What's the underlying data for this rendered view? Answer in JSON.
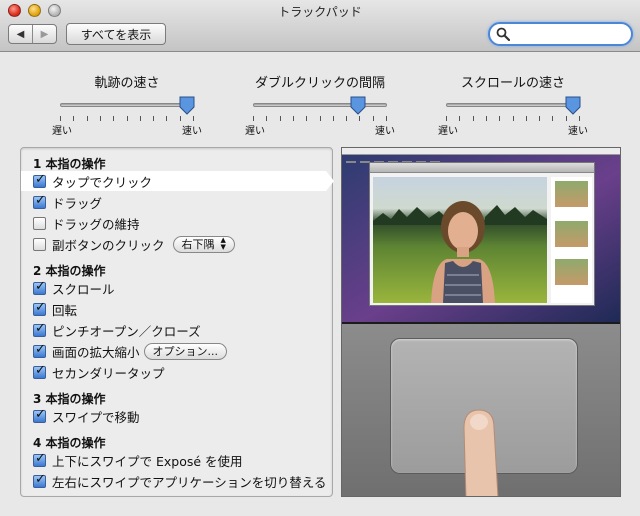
{
  "window": {
    "title": "トラックパッド"
  },
  "toolbar": {
    "back_label": "◀",
    "forward_label": "▶",
    "show_all_label": "すべてを表示",
    "search_value": "",
    "search_placeholder": ""
  },
  "sliders": [
    {
      "title": "軌跡の速さ",
      "min_label": "遅い",
      "max_label": "速い",
      "value_fraction": 0.95
    },
    {
      "title": "ダブルクリックの間隔",
      "min_label": "遅い",
      "max_label": "速い",
      "value_fraction": 0.78
    },
    {
      "title": "スクロールの速さ",
      "min_label": "遅い",
      "max_label": "速い",
      "value_fraction": 0.95
    }
  ],
  "options": {
    "one_finger": {
      "title": "1 本指の操作",
      "tap_to_click": {
        "label": "タップでクリック",
        "checked": true
      },
      "dragging": {
        "label": "ドラッグ",
        "checked": true
      },
      "drag_lock": {
        "label": "ドラッグの維持",
        "checked": false
      },
      "secondary_click": {
        "label": "副ボタンのクリック",
        "checked": false,
        "popup_value": "右下隅"
      }
    },
    "two_fingers": {
      "title": "2 本指の操作",
      "scroll": {
        "label": "スクロール",
        "checked": true
      },
      "rotate": {
        "label": "回転",
        "checked": true
      },
      "pinch": {
        "label": "ピンチオープン／クローズ",
        "checked": true
      },
      "zoom": {
        "label": "画面の拡大縮小",
        "checked": true,
        "button_label": "オプション..."
      },
      "secondary_tap": {
        "label": "セカンダリータップ",
        "checked": true
      }
    },
    "three_fingers": {
      "title": "3 本指の操作",
      "swipe": {
        "label": "スワイプで移動",
        "checked": true
      }
    },
    "four_fingers": {
      "title": "4 本指の操作",
      "expose": {
        "label": "上下にスワイプで Exposé を使用",
        "checked": true
      },
      "app_switch": {
        "label": "左右にスワイプでアプリケーションを切り替える",
        "checked": true
      }
    }
  },
  "colors": {
    "accent": "#3b78d1",
    "focus_ring": "#4e86d6",
    "panel": "#ececec"
  }
}
